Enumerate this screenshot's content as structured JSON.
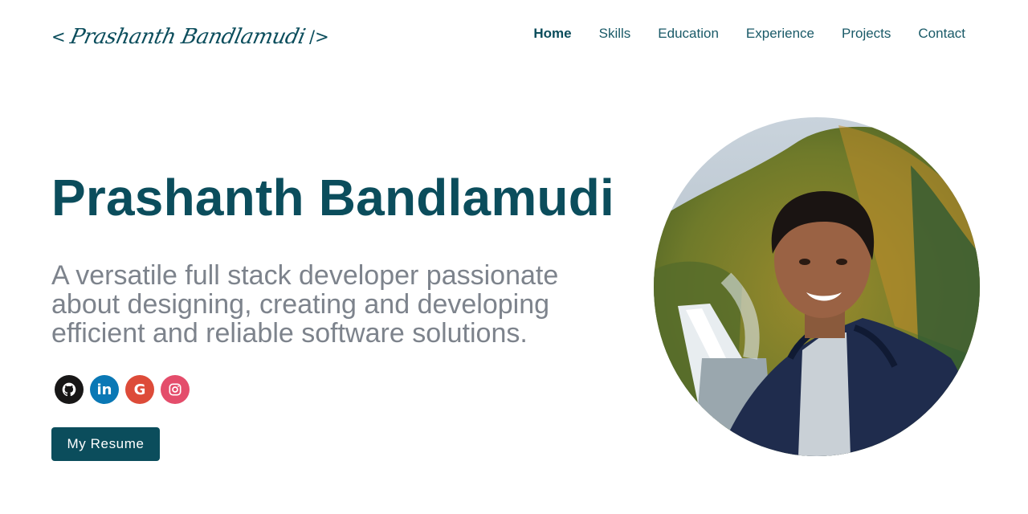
{
  "header": {
    "logo_open": "<",
    "logo_signature": "Prashanth Bandlamudi",
    "logo_close": "/>"
  },
  "nav": {
    "items": [
      {
        "label": "Home",
        "active": true
      },
      {
        "label": "Skills"
      },
      {
        "label": "Education"
      },
      {
        "label": "Experience"
      },
      {
        "label": "Projects"
      },
      {
        "label": "Contact"
      }
    ]
  },
  "hero": {
    "name": "Prashanth Bandlamudi",
    "tagline": "A versatile full stack developer passionate about designing, creating and developing efficient and reliable software solutions.",
    "resume_button": "My Resume"
  },
  "socials": [
    {
      "name": "github-icon",
      "color": "#181717"
    },
    {
      "name": "linkedin-icon",
      "color": "#0a78b5",
      "glyph": "in"
    },
    {
      "name": "google-icon",
      "color": "#dd4b39",
      "glyph": "G"
    },
    {
      "name": "instagram-icon",
      "color": "#e44d6b"
    }
  ],
  "colors": {
    "primary": "#0b4d5c",
    "tagline": "#7d838c"
  }
}
